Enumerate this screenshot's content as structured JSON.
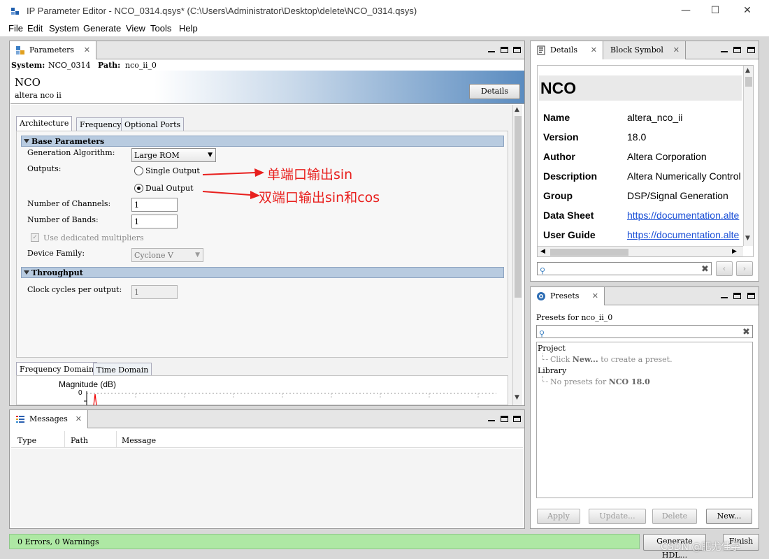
{
  "window": {
    "title": "IP Parameter Editor - NCO_0314.qsys* (C:\\Users\\Administrator\\Desktop\\delete\\NCO_0314.qsys)",
    "minimize": "—",
    "maximize": "☐",
    "close": "✕"
  },
  "menu": [
    "File",
    "Edit",
    "System",
    "Generate",
    "View",
    "Tools",
    "Help"
  ],
  "parameters_panel": {
    "tab_label": "Parameters",
    "system_label": "System:",
    "system_value": "NCO_0314",
    "path_label": "Path:",
    "path_value": "nco_ii_0",
    "header_title": "NCO",
    "header_subtitle": "altera nco ii",
    "details_button": "Details",
    "tabs": [
      "Architecture",
      "Frequency",
      "Optional Ports"
    ],
    "base_parameters": {
      "title": "Base Parameters",
      "generation_algorithm_label": "Generation Algorithm:",
      "generation_algorithm_value": "Large ROM",
      "outputs_label": "Outputs:",
      "output_single": "Single Output",
      "output_dual": "Dual Output",
      "selected_output": "Dual Output",
      "channels_label": "Number of Channels:",
      "channels_value": "1",
      "bands_label": "Number of Bands:",
      "bands_value": "1",
      "dedicated_multipliers_label": "Use dedicated multipliers",
      "device_family_label": "Device Family:",
      "device_family_value": "Cyclone V"
    },
    "throughput": {
      "title": "Throughput",
      "clock_cycles_label": "Clock cycles per output:",
      "clock_cycles_value": "1"
    },
    "plot_tabs": [
      "Frequency Domain",
      "Time Domain"
    ],
    "plot_ylabel": "Magnitude (dB)",
    "plot_tick_zero": "0"
  },
  "annotations": {
    "single": "单端口输出sin",
    "dual": "双端口输出sin和cos",
    "color": "#e8201e"
  },
  "details_panel": {
    "tab_label": "Details",
    "block_symbol_tab": "Block Symbol",
    "title": "NCO",
    "rows": [
      {
        "key": "Name",
        "value": "altera_nco_ii"
      },
      {
        "key": "Version",
        "value": "18.0"
      },
      {
        "key": "Author",
        "value": "Altera Corporation"
      },
      {
        "key": "Description",
        "value": "Altera Numerically Control"
      },
      {
        "key": "Group",
        "value": "DSP/Signal Generation"
      },
      {
        "key": "Data Sheet",
        "value": "https://documentation.alte"
      },
      {
        "key": "User Guide",
        "value": "https://documentation.alte"
      }
    ]
  },
  "presets_panel": {
    "tab_label": "Presets",
    "presets_for": "Presets for nco_ii_0",
    "project_label": "Project",
    "project_hint_prefix": "Click",
    "project_hint_bold": "New...",
    "project_hint_suffix": "to create a preset.",
    "library_label": "Library",
    "library_hint_prefix": "No presets for",
    "library_hint_bold": "NCO 18.0",
    "buttons": {
      "apply": "Apply",
      "update": "Update...",
      "delete": "Delete",
      "new": "New..."
    }
  },
  "messages_panel": {
    "tab_label": "Messages",
    "columns": [
      "Type",
      "Path",
      "Message"
    ]
  },
  "status_bar": {
    "text": "0 Errors, 0 Warnings",
    "generate_button": "Generate HDL...",
    "finish_button": "Finish",
    "watermark": "CSDN @肥尤佳学"
  }
}
